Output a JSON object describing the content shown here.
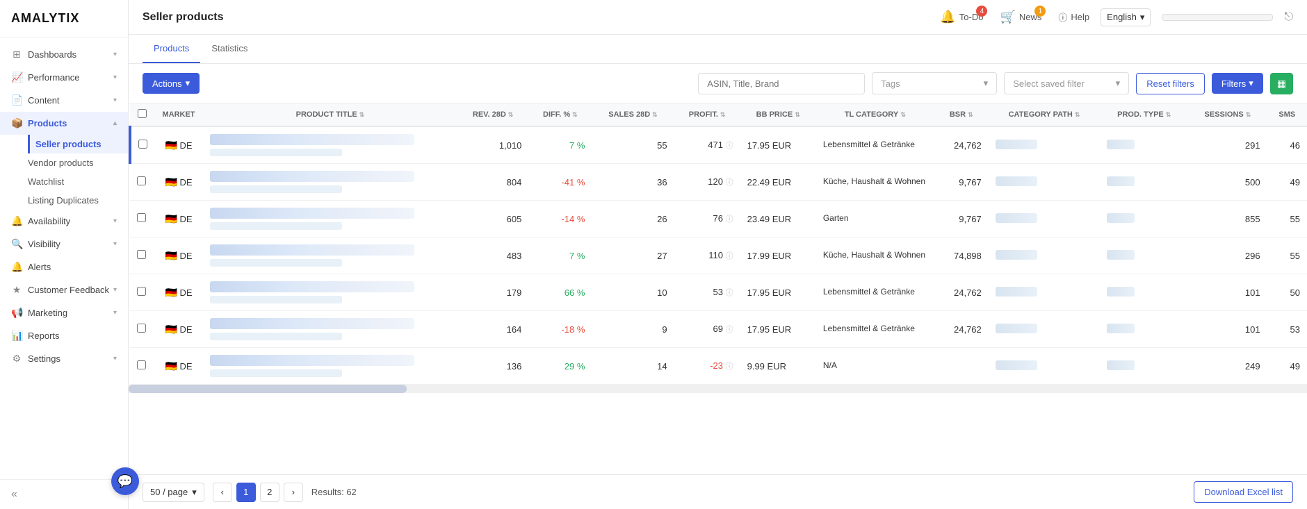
{
  "app": {
    "name": "AMALYTIX"
  },
  "topbar": {
    "title": "Seller products",
    "todo_label": "To-Do",
    "todo_count": "4",
    "news_label": "News",
    "news_count": "1",
    "help_label": "Help",
    "language": "English",
    "logout_icon": "→"
  },
  "sidebar": {
    "items": [
      {
        "id": "dashboards",
        "label": "Dashboards",
        "icon": "⊞",
        "expandable": true
      },
      {
        "id": "performance",
        "label": "Performance",
        "icon": "📈",
        "expandable": true
      },
      {
        "id": "content",
        "label": "Content",
        "icon": "📄",
        "expandable": true
      },
      {
        "id": "products",
        "label": "Products",
        "icon": "📦",
        "expandable": true,
        "active": true
      },
      {
        "id": "availability",
        "label": "Availability",
        "icon": "🔔",
        "expandable": true
      },
      {
        "id": "visibility",
        "label": "Visibility",
        "icon": "🔍",
        "expandable": true
      },
      {
        "id": "alerts",
        "label": "Alerts",
        "icon": "🔔",
        "expandable": false
      },
      {
        "id": "customer-feedback",
        "label": "Customer Feedback",
        "icon": "★",
        "expandable": true
      },
      {
        "id": "marketing",
        "label": "Marketing",
        "icon": "📢",
        "expandable": true
      },
      {
        "id": "reports",
        "label": "Reports",
        "icon": "📊",
        "expandable": false
      },
      {
        "id": "settings",
        "label": "Settings",
        "icon": "⚙",
        "expandable": true
      }
    ],
    "products_sub": [
      {
        "id": "seller-products",
        "label": "Seller products",
        "active": true
      },
      {
        "id": "vendor-products",
        "label": "Vendor products",
        "active": false
      },
      {
        "id": "watchlist",
        "label": "Watchlist",
        "active": false
      },
      {
        "id": "listing-duplicates",
        "label": "Listing Duplicates",
        "active": false
      }
    ]
  },
  "tabs": [
    {
      "id": "products",
      "label": "Products",
      "active": true
    },
    {
      "id": "statistics",
      "label": "Statistics",
      "active": false
    }
  ],
  "toolbar": {
    "actions_label": "Actions",
    "search_placeholder": "ASIN, Title, Brand",
    "tags_placeholder": "Tags",
    "saved_filter_placeholder": "Select saved filter",
    "reset_label": "Reset filters",
    "filters_label": "Filters"
  },
  "table": {
    "columns": [
      {
        "id": "check",
        "label": ""
      },
      {
        "id": "market",
        "label": "MARKET"
      },
      {
        "id": "title",
        "label": "PRODUCT TITLE"
      },
      {
        "id": "rev",
        "label": "REV. 28D"
      },
      {
        "id": "diff",
        "label": "DIFF. %"
      },
      {
        "id": "sales",
        "label": "SALES 28D"
      },
      {
        "id": "profit",
        "label": "PROFIT."
      },
      {
        "id": "bb_price",
        "label": "BB PRICE"
      },
      {
        "id": "tl_category",
        "label": "TL CATEGORY"
      },
      {
        "id": "bsr",
        "label": "BSR"
      },
      {
        "id": "category_path",
        "label": "CATEGORY PATH"
      },
      {
        "id": "prod_type",
        "label": "PROD. TYPE"
      },
      {
        "id": "sessions",
        "label": "SESSIONS"
      },
      {
        "id": "sms",
        "label": "SMS"
      }
    ],
    "rows": [
      {
        "market": "DE",
        "rev": "1,010",
        "diff": "7 %",
        "diff_type": "pos",
        "sales": "55",
        "profit": "471",
        "bb_price": "17.95 EUR",
        "tl_category": "Lebensmittel & Getränke",
        "bsr": "24,762",
        "sessions": "291",
        "sms": "46"
      },
      {
        "market": "DE",
        "rev": "804",
        "diff": "-41 %",
        "diff_type": "neg",
        "sales": "36",
        "profit": "120",
        "bb_price": "22.49 EUR",
        "tl_category": "Küche, Haushalt & Wohnen",
        "bsr": "9,767",
        "sessions": "500",
        "sms": "49"
      },
      {
        "market": "DE",
        "rev": "605",
        "diff": "-14 %",
        "diff_type": "neg",
        "sales": "26",
        "profit": "76",
        "bb_price": "23.49 EUR",
        "tl_category": "Garten",
        "bsr": "9,767",
        "sessions": "855",
        "sms": "55"
      },
      {
        "market": "DE",
        "rev": "483",
        "diff": "7 %",
        "diff_type": "pos",
        "sales": "27",
        "profit": "110",
        "bb_price": "17.99 EUR",
        "tl_category": "Küche, Haushalt & Wohnen",
        "bsr": "74,898",
        "sessions": "296",
        "sms": "55"
      },
      {
        "market": "DE",
        "rev": "179",
        "diff": "66 %",
        "diff_type": "pos",
        "sales": "10",
        "profit": "53",
        "bb_price": "17.95 EUR",
        "tl_category": "Lebensmittel & Getränke",
        "bsr": "24,762",
        "sessions": "101",
        "sms": "50"
      },
      {
        "market": "DE",
        "rev": "164",
        "diff": "-18 %",
        "diff_type": "neg",
        "sales": "9",
        "profit": "69",
        "bb_price": "17.95 EUR",
        "tl_category": "Lebensmittel & Getränke",
        "bsr": "24,762",
        "sessions": "101",
        "sms": "53"
      },
      {
        "market": "DE",
        "rev": "136",
        "diff": "29 %",
        "diff_type": "pos",
        "sales": "14",
        "profit": "-23",
        "bb_price": "9.99 EUR",
        "tl_category": "N/A",
        "bsr": "",
        "sessions": "249",
        "sms": "49"
      }
    ]
  },
  "footer": {
    "page_size": "50 / page",
    "current_page": "1",
    "next_page": "2",
    "results_label": "Results: 62",
    "download_label": "Download Excel list"
  },
  "chat": {
    "icon": "💬"
  }
}
